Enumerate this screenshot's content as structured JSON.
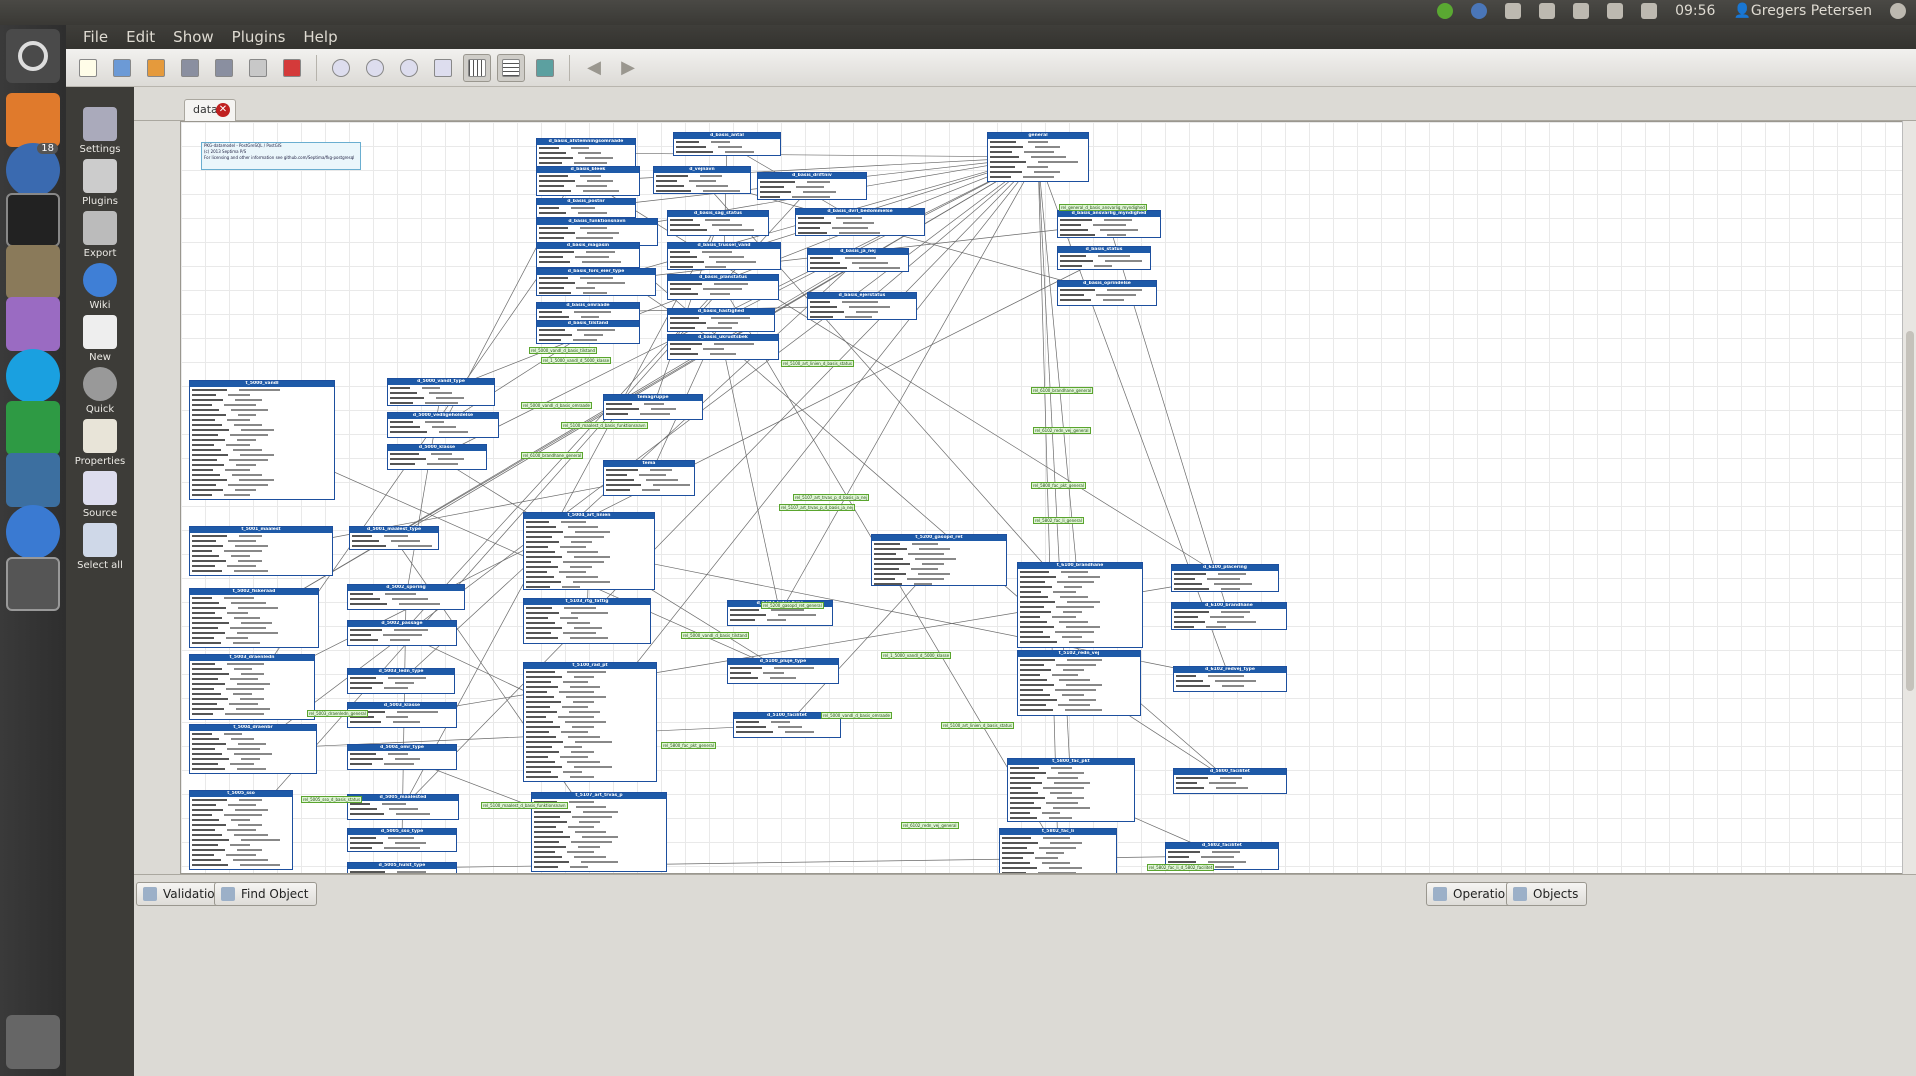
{
  "topbar": {
    "time": "09:56",
    "user": "Gregers Petersen"
  },
  "menu": [
    "File",
    "Edit",
    "Show",
    "Plugins",
    "Help"
  ],
  "side_buttons": [
    "Settings",
    "Plugins",
    "Export",
    "Wiki",
    "New",
    "Quick",
    "Properties",
    "Source",
    "Select all"
  ],
  "launcher_badge": "18",
  "tab": {
    "label": "data"
  },
  "status_left": [
    "Validation",
    "Find Object"
  ],
  "status_right": [
    "Operations",
    "Objects"
  ],
  "info_lines": [
    "PKG-datamodel - PostGreSQL / PostGIS",
    "(c) 2013 Septima P/S",
    "For licensing and other information see github.com/Septima/fkg-postgresql"
  ],
  "tables": [
    {
      "name": "d_basis_afstemningsomraade"
    },
    {
      "name": "d_basis_antal"
    },
    {
      "name": "general"
    },
    {
      "name": "d_basis_bleek"
    },
    {
      "name": "d_vejnavn"
    },
    {
      "name": "d_basis_driftniv"
    },
    {
      "name": "d_basis_postnr"
    },
    {
      "name": "d_basis_sag_status"
    },
    {
      "name": "d_basis_dvrl_bedommelse"
    },
    {
      "name": "d_basis_funktionsnavn"
    },
    {
      "name": "d_basis_ansvarlig_myndighed"
    },
    {
      "name": "d_basis_magasin"
    },
    {
      "name": "d_basis_trussel_vand"
    },
    {
      "name": "d_basis_ja_nej"
    },
    {
      "name": "d_basis_status"
    },
    {
      "name": "d_basis_fors_eier_type"
    },
    {
      "name": "d_basis_planstatus"
    },
    {
      "name": "d_basis_oprindelse"
    },
    {
      "name": "d_basis_ejerstatus"
    },
    {
      "name": "d_basis_omraade"
    },
    {
      "name": "d_basis_tilstand"
    },
    {
      "name": "d_basis_hastighed"
    },
    {
      "name": "d_basis_ukrudtsbek"
    },
    {
      "name": "t_5000_vandl"
    },
    {
      "name": "d_5000_vandl_type"
    },
    {
      "name": "d_5000_vedligeholdelse"
    },
    {
      "name": "temagruppe"
    },
    {
      "name": "d_5000_klasse"
    },
    {
      "name": "tema"
    },
    {
      "name": "t_5001_maalest"
    },
    {
      "name": "d_5001_maalest_type"
    },
    {
      "name": "t_5004_art_linien"
    },
    {
      "name": "t_5200_gasopd_ret"
    },
    {
      "name": "t_6100_brandhane"
    },
    {
      "name": "d_6100_placering"
    },
    {
      "name": "d_6100_brandhane"
    },
    {
      "name": "t_5002_fiskeraad"
    },
    {
      "name": "d_5002_sporing"
    },
    {
      "name": "t_5103_rtg_fattig"
    },
    {
      "name": "d_5103_lyder_type"
    },
    {
      "name": "d_5002_passage"
    },
    {
      "name": "t_5102_redn_vej"
    },
    {
      "name": "d_6102_redvej_type"
    },
    {
      "name": "t_5003_draenledn"
    },
    {
      "name": "d_5003_ledn_type"
    },
    {
      "name": "t_5100_rad_pt"
    },
    {
      "name": "d_5100_pluje_type"
    },
    {
      "name": "d_5003_klasse"
    },
    {
      "name": "t_5004_draenbr"
    },
    {
      "name": "d_5100_facilitet"
    },
    {
      "name": "d_5004_omr_type"
    },
    {
      "name": "t_5800_fac_pkt"
    },
    {
      "name": "d_5800_facilitet"
    },
    {
      "name": "t_5005_sso"
    },
    {
      "name": "d_5005_maalested"
    },
    {
      "name": "t_5107_art_trvas_p"
    },
    {
      "name": "d_5005_sso_type"
    },
    {
      "name": "t_5802_fac_li"
    },
    {
      "name": "d_5802_facilitet"
    },
    {
      "name": "d_5005_hulst_type"
    }
  ],
  "relationships": [
    "rel_5000_vandl_d_basis_tilstand",
    "rel_1_5000_vandl_d_5000_klasse",
    "rel_5000_vandl_d_basis_omraade",
    "rel_5100_maalest_d_basis_funktionsnavn",
    "rel_5100_art_linien_d_basis_status",
    "rel_5107_art_trvas_p_d_basis_ja_nej",
    "rel_6100_brandhane_general",
    "rel_6102_redn_vej_general",
    "rel_5800_fac_pkt_general",
    "rel_5802_fac_li_general",
    "rel_5200_gasopd_ret_general",
    "rel_general_d_basis_ansvarlig_myndighed",
    "rel_5802_fac_li_d_5802_facilitet",
    "rel_5005_sso_d_basis_status",
    "rel_5003_draenledn_general"
  ]
}
